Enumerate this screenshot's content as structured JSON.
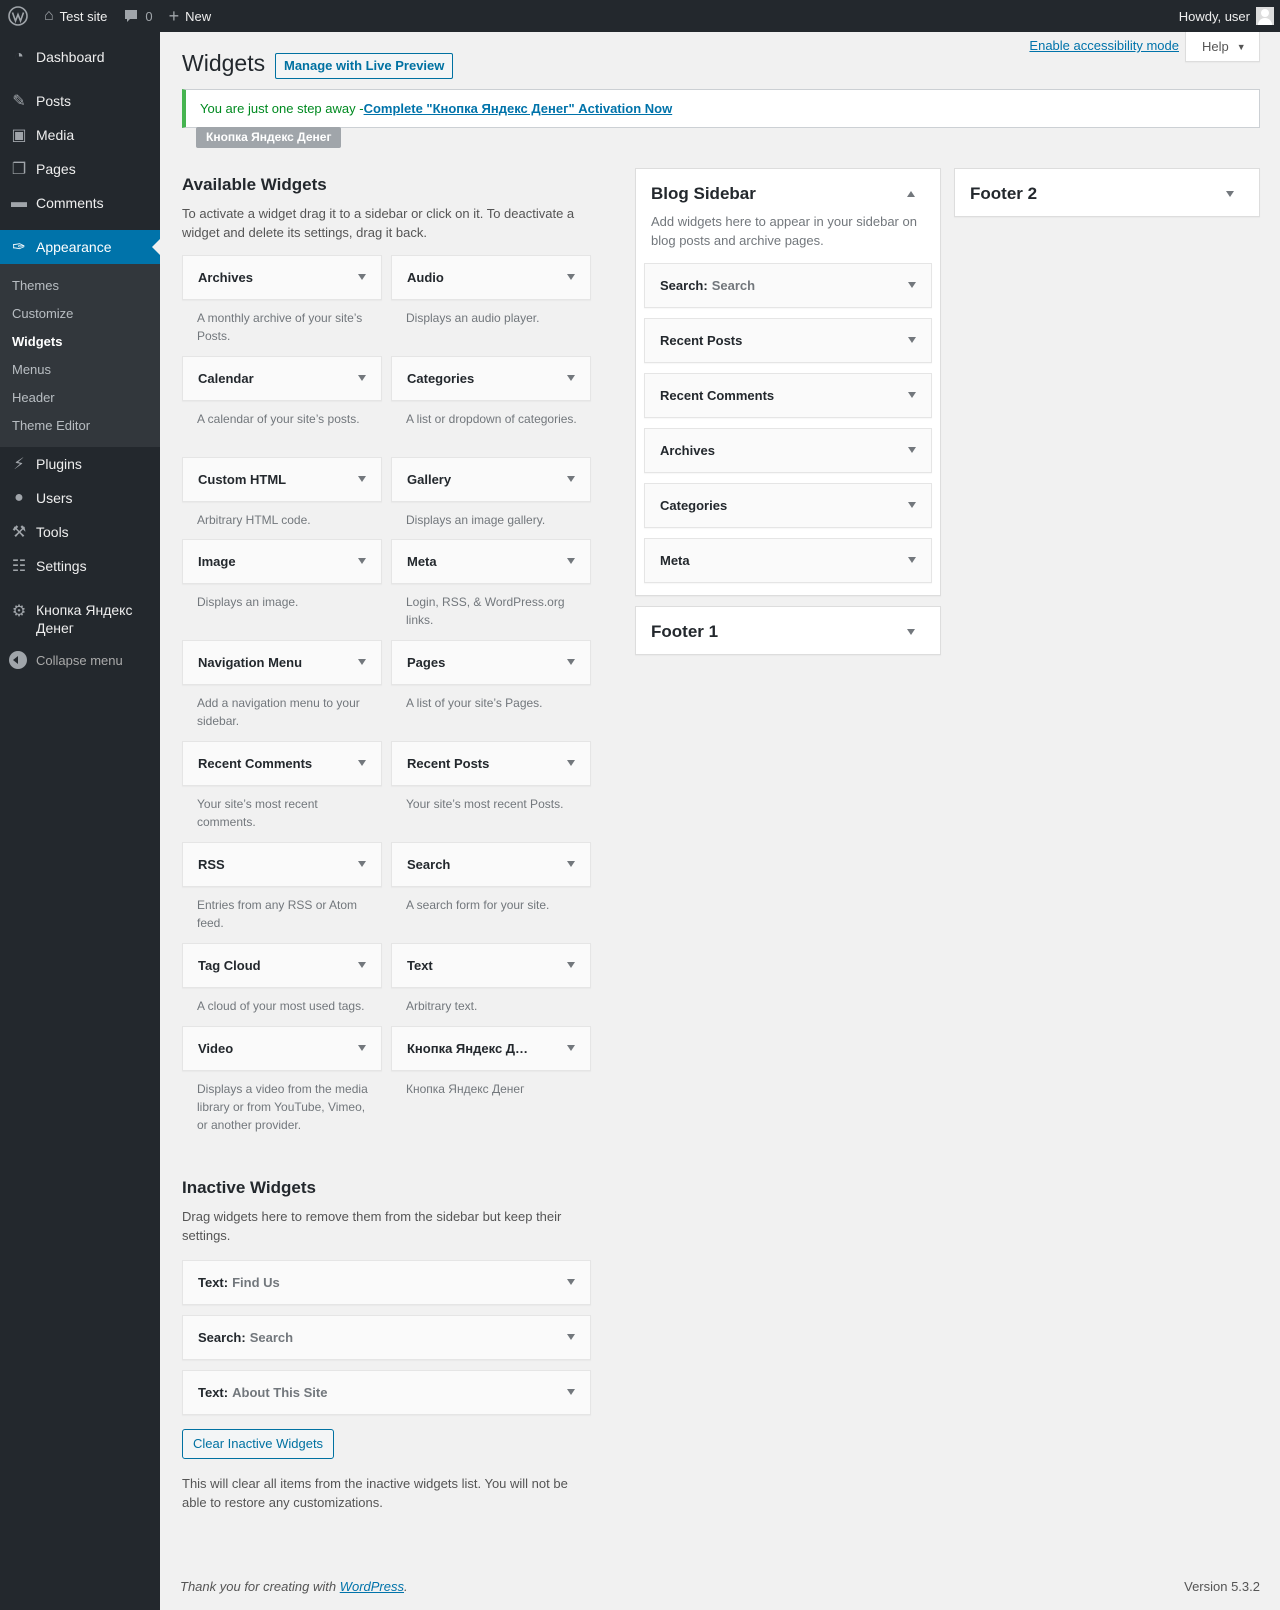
{
  "adminbar": {
    "site_name": "Test site",
    "comments_count": "0",
    "new_label": "New",
    "howdy": "Howdy, user"
  },
  "menu": {
    "dashboard": "Dashboard",
    "posts": "Posts",
    "media": "Media",
    "pages": "Pages",
    "comments": "Comments",
    "appearance": "Appearance",
    "appearance_sub": [
      "Themes",
      "Customize",
      "Widgets",
      "Menus",
      "Header",
      "Theme Editor"
    ],
    "plugins": "Plugins",
    "users": "Users",
    "tools": "Tools",
    "settings": "Settings",
    "yandex": "Кнопка Яндекс Денег",
    "collapse": "Collapse menu"
  },
  "screen_meta": {
    "accessibility": "Enable accessibility mode",
    "help": "Help"
  },
  "page": {
    "title": "Widgets",
    "live_preview": "Manage with Live Preview"
  },
  "notice": {
    "text": "You are just one step away - ",
    "link": "Complete \"Кнопка Яндекс Денег\" Activation Now",
    "badge": "Кнопка Яндекс Денег"
  },
  "available": {
    "title": "Available Widgets",
    "description": "To activate a widget drag it to a sidebar or click on it. To deactivate a widget and delete its settings, drag it back.",
    "widgets": [
      {
        "name": "Archives",
        "desc": "A monthly archive of your site’s Posts."
      },
      {
        "name": "Audio",
        "desc": "Displays an audio player."
      },
      {
        "name": "Calendar",
        "desc": "A calendar of your site’s posts."
      },
      {
        "name": "Categories",
        "desc": "A list or dropdown of categories."
      },
      {
        "name": "Custom HTML",
        "desc": "Arbitrary HTML code."
      },
      {
        "name": "Gallery",
        "desc": "Displays an image gallery."
      },
      {
        "name": "Image",
        "desc": "Displays an image."
      },
      {
        "name": "Meta",
        "desc": "Login, RSS, & WordPress.org links."
      },
      {
        "name": "Navigation Menu",
        "desc": "Add a navigation menu to your sidebar."
      },
      {
        "name": "Pages",
        "desc": "A list of your site’s Pages."
      },
      {
        "name": "Recent Comments",
        "desc": "Your site’s most recent comments."
      },
      {
        "name": "Recent Posts",
        "desc": "Your site’s most recent Posts."
      },
      {
        "name": "RSS",
        "desc": "Entries from any RSS or Atom feed."
      },
      {
        "name": "Search",
        "desc": "A search form for your site."
      },
      {
        "name": "Tag Cloud",
        "desc": "A cloud of your most used tags."
      },
      {
        "name": "Text",
        "desc": "Arbitrary text."
      },
      {
        "name": "Video",
        "desc": "Displays a video from the media library or from YouTube, Vimeo, or another provider."
      },
      {
        "name": "Кнопка Яндекс Д…",
        "desc": "Кнопка Яндекс Денег"
      }
    ]
  },
  "blog_sidebar": {
    "title": "Blog Sidebar",
    "description": "Add widgets here to appear in your sidebar on blog posts and archive pages.",
    "widgets": [
      {
        "name": "Search:",
        "instance": "Search"
      },
      {
        "name": "Recent Posts",
        "instance": ""
      },
      {
        "name": "Recent Comments",
        "instance": ""
      },
      {
        "name": "Archives",
        "instance": ""
      },
      {
        "name": "Categories",
        "instance": ""
      },
      {
        "name": "Meta",
        "instance": ""
      }
    ]
  },
  "footer1": {
    "title": "Footer 1"
  },
  "footer2": {
    "title": "Footer 2"
  },
  "inactive": {
    "title": "Inactive Widgets",
    "description": "Drag widgets here to remove them from the sidebar but keep their settings.",
    "widgets": [
      {
        "name": "Text:",
        "instance": "Find Us"
      },
      {
        "name": "Search:",
        "instance": "Search"
      },
      {
        "name": "Text:",
        "instance": "About This Site"
      }
    ],
    "clear_button": "Clear Inactive Widgets",
    "clear_note": "This will clear all items from the inactive widgets list. You will not be able to restore any customizations."
  },
  "footer": {
    "thanks_prefix": "Thank you for creating with ",
    "wordpress_link": "WordPress",
    "thanks_suffix": ".",
    "version": "Version 5.3.2"
  }
}
